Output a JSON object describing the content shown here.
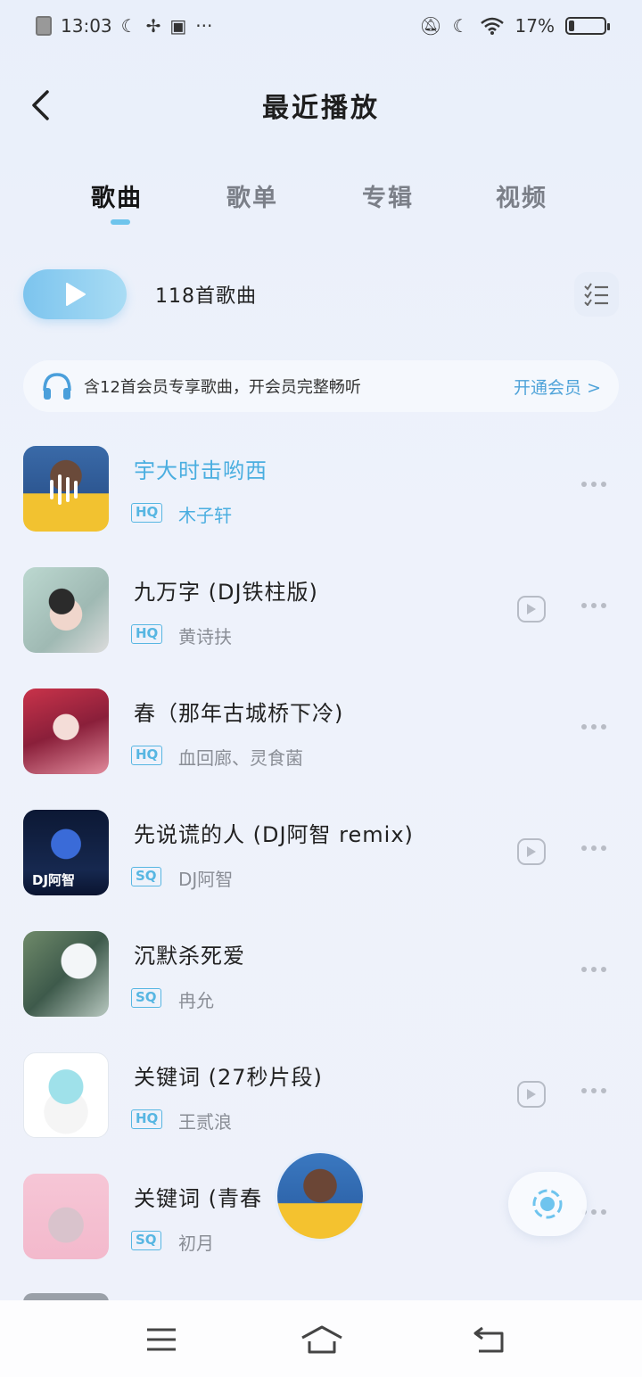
{
  "status_bar": {
    "time": "13:03",
    "battery": "17%",
    "battery_level": 0.17
  },
  "header": {
    "title": "最近播放"
  },
  "tabs": [
    {
      "label": "歌曲",
      "active": true
    },
    {
      "label": "歌单",
      "active": false
    },
    {
      "label": "专辑",
      "active": false
    },
    {
      "label": "视频",
      "active": false
    }
  ],
  "play_all": {
    "count_label": "118首歌曲"
  },
  "vip_banner": {
    "text": "含12首会员专享歌曲，开会员完整畅听",
    "link": "开通会员 >"
  },
  "songs": [
    {
      "title": "宇大时击哟西",
      "quality": "HQ",
      "artist": "木子轩",
      "playing": true,
      "has_mv": false
    },
    {
      "title": "九万字 (DJ铁柱版)",
      "quality": "HQ",
      "artist": "黄诗扶",
      "playing": false,
      "has_mv": true
    },
    {
      "title": "春（那年古城桥下冷)",
      "quality": "HQ",
      "artist": "血回廊、灵食菌",
      "playing": false,
      "has_mv": false
    },
    {
      "title": "先说谎的人 (DJ阿智 remix)",
      "quality": "SQ",
      "artist": "DJ阿智",
      "playing": false,
      "has_mv": true
    },
    {
      "title": "沉默杀死爱",
      "quality": "SQ",
      "artist": "冉允",
      "playing": false,
      "has_mv": false
    },
    {
      "title": "关键词 (27秒片段)",
      "quality": "HQ",
      "artist": "王贰浪",
      "playing": false,
      "has_mv": true
    },
    {
      "title": "关键词 (青春",
      "quality": "SQ",
      "artist": "初月",
      "playing": false,
      "has_mv": false
    }
  ],
  "colors": {
    "accent": "#4aaee0",
    "badge": "#57b6e2",
    "play_button": "#7cc4ee"
  },
  "icons": {
    "back": "chevron-left-icon",
    "play": "play-icon",
    "list_mode": "checklist-icon",
    "headphones": "headphones-icon",
    "mv": "video-play-icon",
    "more": "more-dots-icon",
    "record": "record-icon",
    "nav_menu": "menu-icon",
    "nav_home": "home-icon",
    "nav_back": "back-icon"
  }
}
